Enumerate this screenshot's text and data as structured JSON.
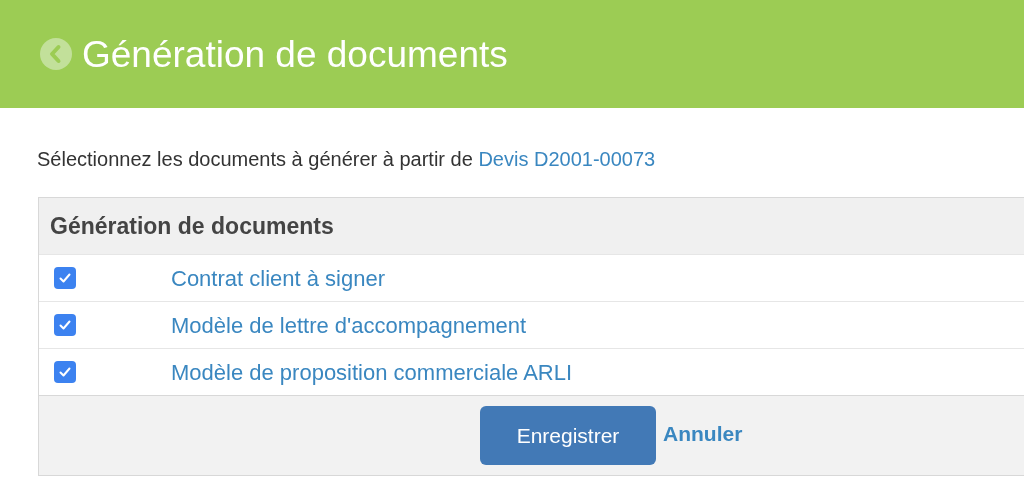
{
  "header": {
    "title": "Génération de documents"
  },
  "intro": {
    "text": "Sélectionnez les documents à générer à partir de",
    "link": "Devis D2001-00073"
  },
  "panel": {
    "heading": "Génération de documents",
    "documents": [
      {
        "label": "Contrat client à signer",
        "checked": true
      },
      {
        "label": "Modèle de lettre d'accompagnement",
        "checked": true
      },
      {
        "label": "Modèle de proposition commerciale ARLI",
        "checked": true
      }
    ],
    "buttons": {
      "save": "Enregistrer",
      "cancel": "Annuler"
    }
  }
}
